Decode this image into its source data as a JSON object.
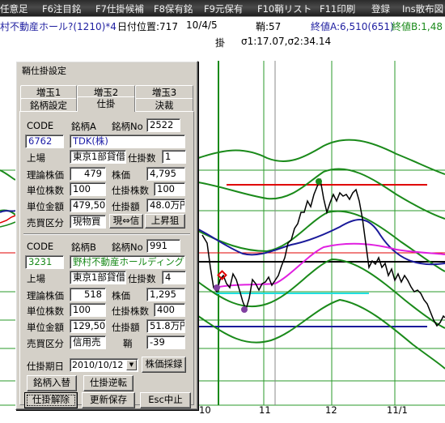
{
  "menubar": {
    "items": [
      "任意足",
      "F6注目銘",
      "F7仕掛候補",
      "F8保有銘",
      "F9元保有",
      "F10鞘リスト",
      "F11印刷",
      "登録",
      "Ins散布図"
    ]
  },
  "infobar": {
    "stock_title": "村不動産ホール?(1210)*4",
    "date_pos_label": "日付位置:717",
    "date": "10/4/5",
    "count_label": "鞘:57",
    "close_a": "終値A:6,510(651)",
    "close_b": "終値B:1,48",
    "sigma": "σ1:17.07,σ2:34.14",
    "marker": "掛"
  },
  "chart_axis": {
    "x_ticks": [
      "10",
      "11",
      "12",
      "11/1"
    ]
  },
  "colors": {
    "menu_bg": "#2b2b2b",
    "title_blue": "#1e1ea0",
    "title_green": "#1a8a1a",
    "line_green": "#1a8a1a",
    "line_red": "#e00000",
    "line_navy": "#1a1a9a",
    "line_magenta": "#e020e0",
    "line_cyan": "#20e0e0"
  },
  "dialog": {
    "title": "鞘仕掛設定",
    "tabs_row1": [
      "増玉1",
      "増玉2",
      "増玉3"
    ],
    "tabs_row2": [
      "銘柄設定",
      "仕掛",
      "決裁"
    ],
    "active_tab": "仕掛",
    "stock_a": {
      "code_label": "CODE",
      "header_label": "銘柄A",
      "no_label": "銘柄No",
      "no_value": "2522",
      "code": "6762",
      "name": "TDK(株)",
      "market_label": "上場",
      "market": "東京1部貸借",
      "qty_label": "仕掛数",
      "qty": "1",
      "theo_price_label": "理論株価",
      "theo_price": "479",
      "price_label": "株価",
      "price": "4,795",
      "unit_qty_label": "単位株数",
      "unit_qty": "100",
      "pos_qty_label": "仕掛株数",
      "pos_qty": "100",
      "unit_amount_label": "単位金額",
      "unit_amount": "479,500",
      "pos_amount_label": "仕掛額",
      "pos_amount": "48.0万円",
      "side_label": "売買区分",
      "side": "現物買",
      "swap_button": "現⇔信",
      "rise_button": "上昇狙"
    },
    "stock_b": {
      "code_label": "CODE",
      "header_label": "銘柄B",
      "no_label": "銘柄No",
      "no_value": "991",
      "code": "3231",
      "name": "野村不動産ホールディング",
      "market_label": "上場",
      "market": "東京1部貸借",
      "qty_label": "仕掛数",
      "qty": "4",
      "theo_price_label": "理論株価",
      "theo_price": "518",
      "price_label": "株価",
      "price": "1,295",
      "unit_qty_label": "単位株数",
      "unit_qty": "100",
      "pos_qty_label": "仕掛株数",
      "pos_qty": "400",
      "unit_amount_label": "単位金額",
      "unit_amount": "129,500",
      "pos_amount_label": "仕掛額",
      "pos_amount": "51.8万円",
      "side_label": "売買区分",
      "side": "信用売",
      "spread_label": "鞘",
      "spread": "-39"
    },
    "period_label": "仕掛期日",
    "period_value": "2010/10/12",
    "price_pick_button": "株価採録",
    "swap_stock_button": "銘柄入替",
    "reverse_button": "仕掛逆転",
    "release_button": "仕掛解除",
    "save_button": "更新保存",
    "cancel_button": "Esc中止"
  }
}
